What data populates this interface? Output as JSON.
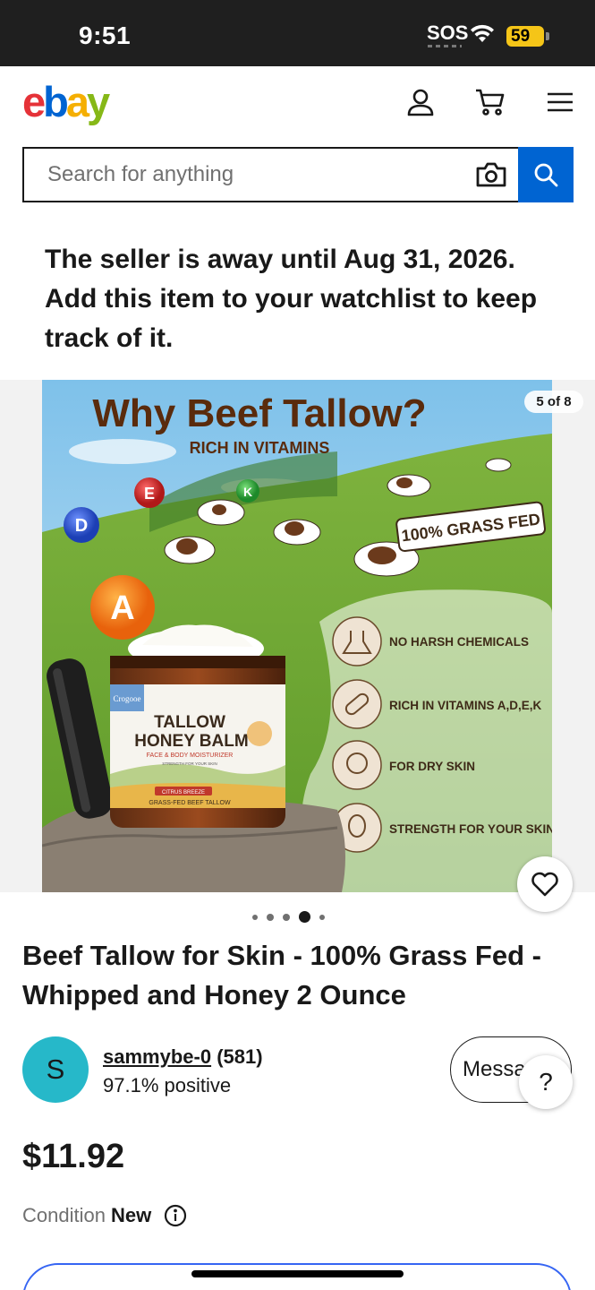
{
  "status_bar": {
    "time": "9:51",
    "sos": "SOS",
    "battery": "59"
  },
  "header": {
    "logo": {
      "e": "e",
      "b": "b",
      "a": "a",
      "y": "y"
    },
    "icons": [
      "account-icon",
      "cart-icon",
      "menu-icon"
    ]
  },
  "search": {
    "placeholder": "Search for anything",
    "value": ""
  },
  "notice": {
    "text": "The seller is away until Aug 31, 2026. Add this item to your watchlist to keep track of it."
  },
  "gallery": {
    "counter": "5 of 8",
    "image": {
      "headline": "Why Beef Tallow?",
      "subhead": "RICH IN VITAMINS",
      "badge": "100% GRASS FED",
      "vitamins": [
        "E",
        "K",
        "D",
        "A"
      ],
      "features": [
        "NO HARSH CHEMICALS",
        "RICH IN VITAMINS A,D,E,K",
        "FOR DRY SKIN",
        "STRENGTH FOR YOUR SKIN"
      ],
      "jar": {
        "brand": "Crogooe",
        "name_line1": "TALLOW",
        "name_line2": "HONEY BALM",
        "tagline": "FACE & BODY MOISTURIZER",
        "subtag": "STRENGTH FOR YOUR SKIN",
        "scent": "CITRUS BREEZE",
        "footer": "GRASS-FED BEEF TALLOW"
      }
    },
    "page_count": 5,
    "active_page": 4
  },
  "listing": {
    "title": "Beef Tallow for Skin - 100% Grass Fed - Whipped and Honey 2 Ounce",
    "price": "$11.92",
    "condition_label": "Condition",
    "condition_value": "New"
  },
  "seller": {
    "initial": "S",
    "name": "sammybe-0",
    "count": "(581)",
    "feedback": "97.1% positive"
  },
  "actions": {
    "message": "Message",
    "help": "?"
  },
  "colors": {
    "ebay_blue": "#0064d2",
    "ebay_red": "#e53238",
    "ebay_yellow": "#f5af02",
    "ebay_green": "#86b817",
    "avatar": "#26b8c9",
    "cta_blue": "#3665f3"
  }
}
